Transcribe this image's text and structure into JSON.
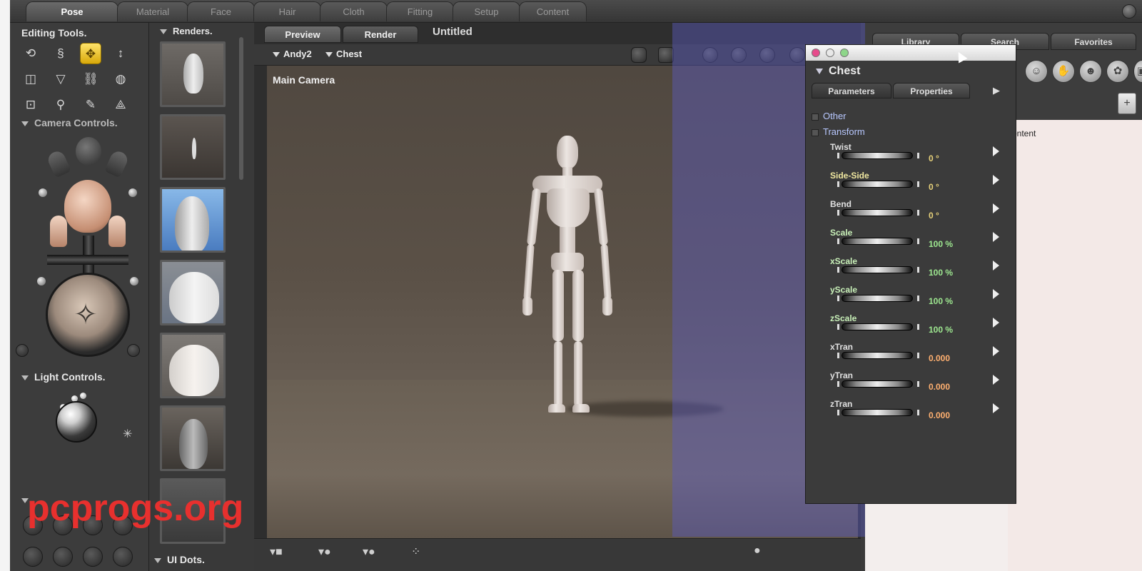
{
  "room_tabs": [
    "Pose",
    "Material",
    "Face",
    "Hair",
    "Cloth",
    "Fitting",
    "Setup",
    "Content"
  ],
  "left_panel": {
    "editing_tools_title": "Editing Tools.",
    "camera_controls_title": "Camera Controls.",
    "light_controls_title": "Light Controls.",
    "ui_dots_title": "UI Dots."
  },
  "renders": {
    "title": "Renders."
  },
  "document": {
    "tabs": [
      "Preview",
      "Render"
    ],
    "title": "Untitled",
    "figure_select": "Andy2",
    "part_select": "Chest",
    "camera_label": "Main Camera"
  },
  "parameters": {
    "header": "Chest",
    "tabs": [
      "Parameters",
      "Properties"
    ],
    "groups": [
      "Other",
      "Transform"
    ],
    "rows": [
      {
        "name": "Twist",
        "value": "0 °",
        "kind": "deg"
      },
      {
        "name": "Side-Side",
        "value": "0 °",
        "kind": "deg"
      },
      {
        "name": "Bend",
        "value": "0 °",
        "kind": "deg"
      },
      {
        "name": "Scale",
        "value": "100 %",
        "kind": "pct"
      },
      {
        "name": "xScale",
        "value": "100 %",
        "kind": "pct"
      },
      {
        "name": "yScale",
        "value": "100 %",
        "kind": "pct"
      },
      {
        "name": "zScale",
        "value": "100 %",
        "kind": "pct"
      },
      {
        "name": "xTran",
        "value": "0.000",
        "kind": "num"
      },
      {
        "name": "yTran",
        "value": "0.000",
        "kind": "num"
      },
      {
        "name": "zTran",
        "value": "0.000",
        "kind": "num"
      }
    ]
  },
  "library": {
    "tabs": [
      "Library",
      "Search",
      "Favorites"
    ],
    "content_label": "ontent"
  },
  "watermark": "pcprogs.org"
}
